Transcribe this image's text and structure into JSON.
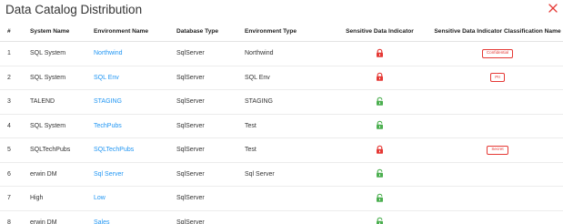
{
  "dialog": {
    "title": "Data Catalog Distribution",
    "close_icon": "close-icon",
    "accent_color": "#e53935",
    "link_color": "#2196f3",
    "locked_color": "#e53935",
    "unlocked_color": "#4caf50"
  },
  "table": {
    "headers": {
      "num": "#",
      "system": "System Name",
      "environment": "Environment Name",
      "db_type": "Database Type",
      "env_type": "Environment Type",
      "sensitive": "Sensitive Data Indicator",
      "classification": "Sensitive Data Indicator Classification Name"
    },
    "rows": [
      {
        "num": "1",
        "system": "SQL System",
        "environment": "Northwind",
        "db_type": "SqlServer",
        "env_type": "Northwind",
        "sensitive_icon": "lock-closed-icon",
        "classification": "Confidential"
      },
      {
        "num": "2",
        "system": "SQL System",
        "environment": "SQL Env",
        "db_type": "SqlServer",
        "env_type": "SQL Env",
        "sensitive_icon": "lock-closed-icon",
        "classification": "PII"
      },
      {
        "num": "3",
        "system": "TALEND",
        "environment": "STAGING",
        "db_type": "SqlServer",
        "env_type": "STAGING",
        "sensitive_icon": "lock-open-icon",
        "classification": ""
      },
      {
        "num": "4",
        "system": "SQL System",
        "environment": "TechPubs",
        "db_type": "SqlServer",
        "env_type": "Test",
        "sensitive_icon": "lock-open-icon",
        "classification": ""
      },
      {
        "num": "5",
        "system": "SQLTechPubs",
        "environment": "SQLTechPubs",
        "db_type": "SqlServer",
        "env_type": "Test",
        "sensitive_icon": "lock-closed-icon",
        "classification": "Secret"
      },
      {
        "num": "6",
        "system": "erwin DM",
        "environment": "Sql Server",
        "db_type": "SqlServer",
        "env_type": "Sql Server",
        "sensitive_icon": "lock-open-icon",
        "classification": ""
      },
      {
        "num": "7",
        "system": "High",
        "environment": "Low",
        "db_type": "SqlServer",
        "env_type": "",
        "sensitive_icon": "lock-open-icon",
        "classification": ""
      },
      {
        "num": "8",
        "system": "erwin DM",
        "environment": "Sales",
        "db_type": "SqlServer",
        "env_type": "",
        "sensitive_icon": "lock-open-icon",
        "classification": ""
      }
    ]
  }
}
